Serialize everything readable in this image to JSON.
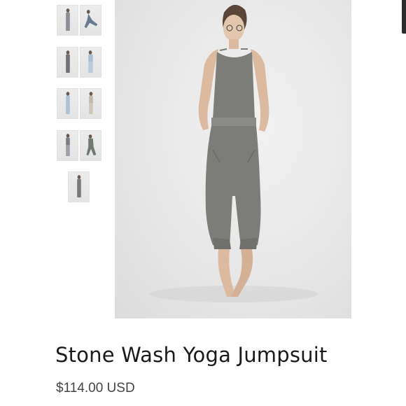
{
  "product": {
    "title": "Stone Wash Yoga Jumpsuit",
    "price": "$114.00 USD",
    "main_image": "model-wearing-gray-jumpsuit",
    "thumbnails": [
      "model-front-thumbnail",
      "model-yoga-pose-thumbnail",
      "model-side-thumbnail",
      "model-light-top-thumbnail",
      "model-front-light-thumbnail",
      "model-standing-thumbnail",
      "model-front-view-thumbnail",
      "model-lunge-thumbnail",
      "model-full-length-thumbnail"
    ]
  },
  "colors": {
    "garment": "#7c7c78",
    "background": "#e8e8e8",
    "title_text": "#1a1a1a",
    "price_text": "#444444"
  }
}
